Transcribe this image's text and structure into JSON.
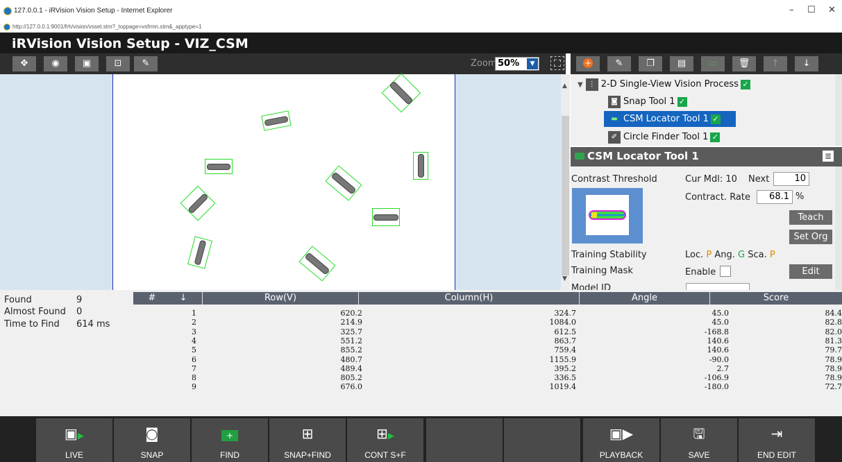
{
  "window": {
    "title": "127.0.0.1 - iRVision Vision Setup - Internet Explorer",
    "url": "http://127.0.0.1:9001/frh/vision/vsset.stm?_toppage=vsfrmn.stm&_apptype=1",
    "minimize": "–",
    "maximize": "☐",
    "close": "✕"
  },
  "app": {
    "title": "iRVision Vision Setup - VIZ_CSM"
  },
  "zoom": {
    "label": "Zoom",
    "value": "50%"
  },
  "tree": {
    "items": [
      {
        "label": "2-D Single-View Vision Process",
        "checked": true
      },
      {
        "label": "Snap Tool 1",
        "checked": true
      },
      {
        "label": "CSM Locator Tool 1",
        "checked": true,
        "selected": true
      },
      {
        "label": "Circle Finder Tool 1",
        "checked": true
      }
    ]
  },
  "csm": {
    "title": "CSM Locator Tool 1",
    "contrast_threshold": "Contrast Threshold",
    "cur_mdl": "Cur Mdl: 10",
    "next_label": "Next",
    "next_value": "10",
    "contract_rate_label": "Contract. Rate",
    "contract_rate_value": "68.1",
    "percent": "%",
    "teach": "Teach",
    "set_org": "Set Org",
    "training_stability": "Training Stability",
    "loc_label": "Loc.",
    "loc_value": "P",
    "ang_label": "Ang.",
    "ang_value": "G",
    "sca_label": "Sca.",
    "sca_value": "P",
    "training_mask": "Training Mask",
    "enable": "Enable",
    "edit": "Edit",
    "model_id": "Model ID"
  },
  "summary": {
    "found_label": "Found",
    "found_value": "9",
    "almost_label": "Almost Found",
    "almost_value": "0",
    "time_label": "Time to Find",
    "time_value": "614 ms"
  },
  "results": {
    "columns": [
      "#",
      "Row(V)",
      "Column(H)",
      "Angle",
      "Score"
    ],
    "rows": [
      [
        "1",
        "620.2",
        "324.7",
        "45.0",
        "84.4"
      ],
      [
        "2",
        "214.9",
        "1084.0",
        "45.0",
        "82.8"
      ],
      [
        "3",
        "325.7",
        "612.5",
        "-168.8",
        "82.0"
      ],
      [
        "4",
        "551.2",
        "863.7",
        "140.6",
        "81.3"
      ],
      [
        "5",
        "855.2",
        "759.4",
        "140.6",
        "79.7"
      ],
      [
        "6",
        "480.7",
        "1155.9",
        "-90.0",
        "78.9"
      ],
      [
        "7",
        "489.4",
        "395.2",
        "2.7",
        "78.9"
      ],
      [
        "8",
        "805.2",
        "336.5",
        "-106.9",
        "78.9"
      ],
      [
        "9",
        "676.0",
        "1019.4",
        "-180.0",
        "72.7"
      ]
    ]
  },
  "bottom": {
    "live": "LIVE",
    "snap": "SNAP",
    "find": "FIND",
    "snap_find": "SNAP+FIND",
    "cont_sf": "CONT S+F",
    "playback": "PLAYBACK",
    "save": "SAVE",
    "end_edit": "END EDIT"
  },
  "colors": {
    "accent": "#1565c0",
    "check": "#18a64a",
    "found_box": "#22dd22"
  }
}
